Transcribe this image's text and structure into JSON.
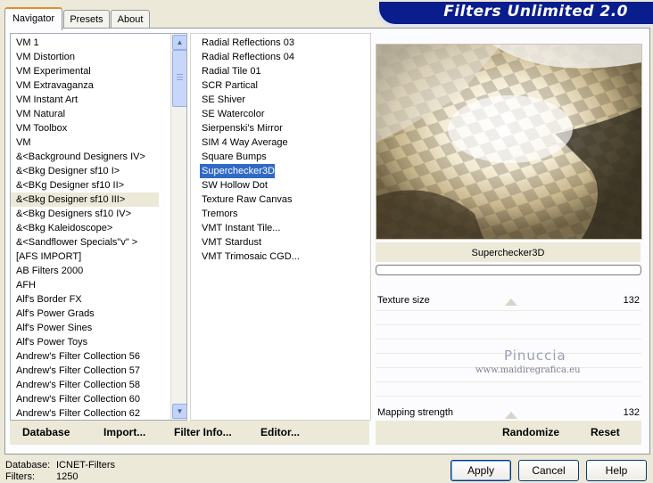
{
  "app_title": "Filters Unlimited 2.0",
  "tabs": [
    {
      "label": "Navigator",
      "active": true
    },
    {
      "label": "Presets",
      "active": false
    },
    {
      "label": "About",
      "active": false
    }
  ],
  "categories": [
    "VM 1",
    "VM Distortion",
    "VM Experimental",
    "VM Extravaganza",
    "VM Instant Art",
    "VM Natural",
    "VM Toolbox",
    "VM",
    "&<Background Designers IV>",
    "&<Bkg Designer sf10 I>",
    "&<BKg Designer sf10 II>",
    "&<Bkg Designer sf10 III>",
    "&<Bkg Designers sf10 IV>",
    "&<Bkg Kaleidoscope>",
    "&<Sandflower Specials\"v\" >",
    "[AFS IMPORT]",
    "AB Filters 2000",
    "AFH",
    "Alf's Border FX",
    "Alf's Power Grads",
    "Alf's Power Sines",
    "Alf's Power Toys",
    "Andrew's Filter Collection 56",
    "Andrew's Filter Collection 57",
    "Andrew's Filter Collection 58",
    "Andrew's Filter Collection 60",
    "Andrew's Filter Collection 62"
  ],
  "categories_selected_index": 11,
  "filters": [
    "Radial Reflections 03",
    "Radial Reflections 04",
    "Radial Tile 01",
    "SCR  Partical",
    "SE Shiver",
    "SE Watercolor",
    "Sierpenski's Mirror",
    "SIM 4 Way Average",
    "Square Bumps",
    "Superchecker3D",
    "SW Hollow Dot",
    "Texture Raw Canvas",
    "Tremors",
    "VMT Instant Tile...",
    "VMT Stardust",
    "VMT Trimosaic CGD..."
  ],
  "filters_selected_index": 9,
  "filter_name": "Superchecker3D",
  "params": {
    "texture_label": "Texture size",
    "texture_value": "132",
    "mapping_label": "Mapping strength",
    "mapping_value": "132"
  },
  "watermark": {
    "line1": "Pinuccia",
    "line2": "www.maidiregrafica.eu"
  },
  "toolbar": {
    "database": "Database",
    "import": "Import...",
    "filter_info": "Filter Info...",
    "editor": "Editor...",
    "randomize": "Randomize",
    "reset": "Reset"
  },
  "status": {
    "database_label": "Database:",
    "database_value": "ICNET-Filters",
    "filters_label": "Filters:",
    "filters_value": "1250"
  },
  "buttons": {
    "apply": "Apply",
    "cancel": "Cancel",
    "help": "Help"
  }
}
